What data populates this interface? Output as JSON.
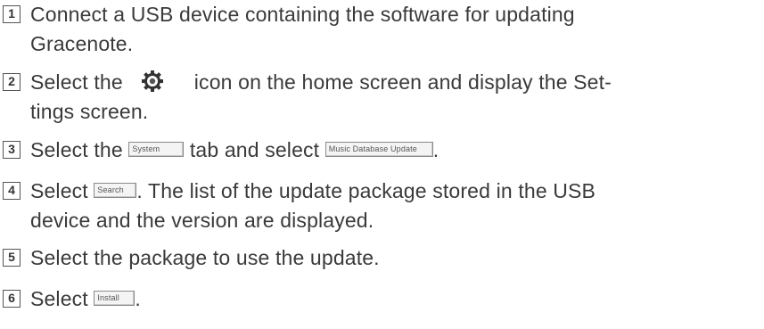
{
  "steps": [
    {
      "number": "1",
      "lines": [
        "Connect a USB device containing the software for updating",
        "Gracenote."
      ]
    },
    {
      "number": "2",
      "before_icon": "Select the",
      "icon": "settings-gear-icon",
      "after_icon": "icon on the home screen and display the Set-",
      "line2": "tings screen."
    },
    {
      "number": "3",
      "part1": "Select the",
      "button1": "System",
      "part2": "tab and select",
      "button2": "Music Database Update",
      "part3": "."
    },
    {
      "number": "4",
      "part1": "Select",
      "button": "Search",
      "part2": ". The list of the update package stored in the USB",
      "line2": "device and the version are displayed."
    },
    {
      "number": "5",
      "text": "Select the package to use the update."
    },
    {
      "number": "6",
      "part1": "Select",
      "button": "Install",
      "part2": "."
    }
  ]
}
